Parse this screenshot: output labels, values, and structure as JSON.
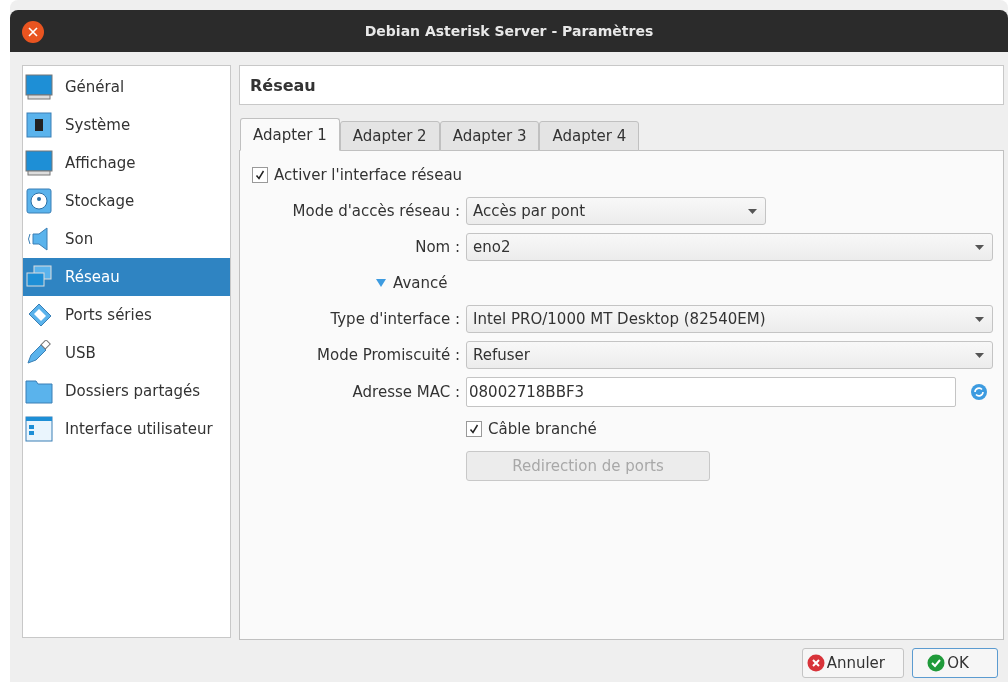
{
  "window": {
    "title": "Debian Asterisk Server - Paramètres"
  },
  "sidebar": {
    "items": [
      {
        "label": "Général",
        "selected": false
      },
      {
        "label": "Système",
        "selected": false
      },
      {
        "label": "Affichage",
        "selected": false
      },
      {
        "label": "Stockage",
        "selected": false
      },
      {
        "label": "Son",
        "selected": false
      },
      {
        "label": "Réseau",
        "selected": true
      },
      {
        "label": "Ports séries",
        "selected": false
      },
      {
        "label": "USB",
        "selected": false
      },
      {
        "label": "Dossiers partagés",
        "selected": false
      },
      {
        "label": "Interface utilisateur",
        "selected": false
      }
    ]
  },
  "section_title": "Réseau",
  "tabs": [
    {
      "label": "Adapter 1",
      "selected": true
    },
    {
      "label": "Adapter 2",
      "selected": false
    },
    {
      "label": "Adapter 3",
      "selected": false
    },
    {
      "label": "Adapter 4",
      "selected": false
    }
  ],
  "rows": [
    {
      "kind": "checkbox",
      "label": "Activer l'interface réseau",
      "checked": true
    },
    {
      "kind": "select",
      "label": "Mode d'accès réseau :",
      "value": "Accès par pont"
    },
    {
      "kind": "select",
      "label": "Nom :",
      "value": "eno2"
    },
    {
      "kind": "toggle",
      "label": "Avancé",
      "expanded": true
    },
    {
      "kind": "select",
      "label": "Type d'interface :",
      "value": "Intel PRO/1000 MT Desktop (82540EM)"
    },
    {
      "kind": "select",
      "label": "Mode Promiscuité :",
      "value": "Refuser"
    },
    {
      "kind": "field",
      "label": "Adresse MAC :",
      "value": "08002718BBF3"
    },
    {
      "kind": "checkbox",
      "label": "Câble branché",
      "checked": true
    },
    {
      "kind": "button",
      "label": "Redirection de ports",
      "disabled": true
    }
  ],
  "buttons": [
    {
      "label": "Annuler",
      "kind": "cancel"
    },
    {
      "label": "OK",
      "kind": "ok"
    }
  ]
}
